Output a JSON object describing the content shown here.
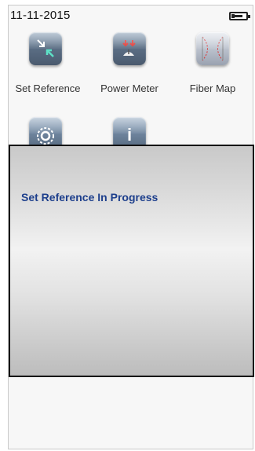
{
  "status": {
    "date": "11-11-2015",
    "battery_icon": "battery-charging-icon"
  },
  "apps": [
    {
      "label": "Set Reference",
      "icon": "set-reference-icon"
    },
    {
      "label": "Power Meter",
      "icon": "power-meter-icon"
    },
    {
      "label": "Fiber Map",
      "icon": "fiber-map-icon"
    },
    {
      "label": "",
      "icon": "light-source-icon"
    },
    {
      "label": "",
      "icon": "info-icon"
    }
  ],
  "dialog": {
    "message": "Set Reference In Progress"
  }
}
